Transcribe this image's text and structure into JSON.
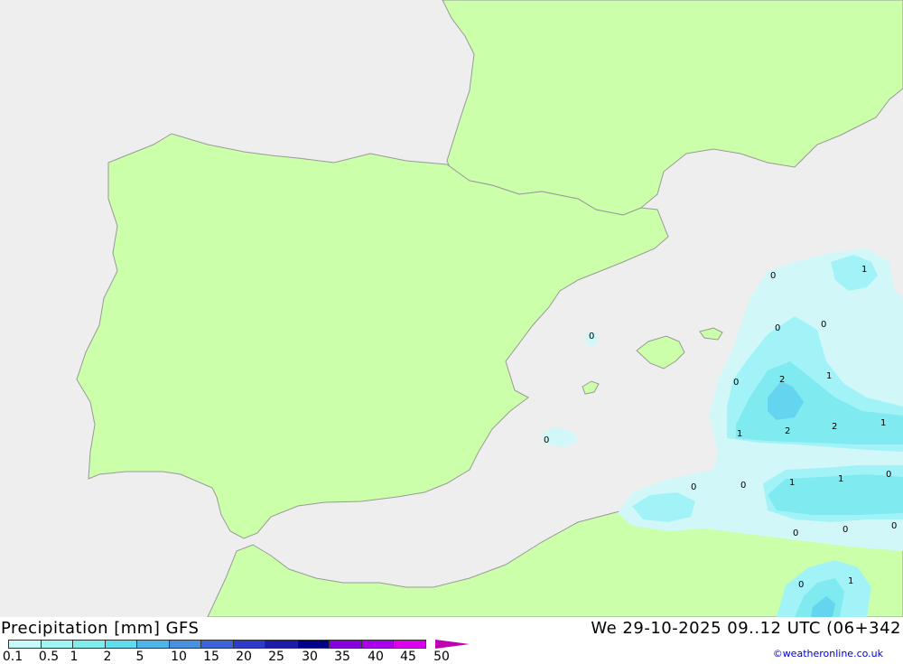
{
  "colors": {
    "sea": "#eeeeee",
    "land": "#ccffaa",
    "coast": "#999999",
    "precip_light": "#d2f7f8",
    "precip_mid": "#a2f3f8",
    "precip_heavy": "#7feaf0",
    "precip_heavier": "#63d5ee"
  },
  "footer": {
    "title": "Precipitation [mm] GFS",
    "valid_time": "We 29-10-2025 09..12 UTC (06+342",
    "copyright": "©weatheronline.co.uk"
  },
  "legend": {
    "colors": [
      "#c8f8f8",
      "#a0f4f4",
      "#80ecec",
      "#60dcec",
      "#50b4e8",
      "#4890e0",
      "#3c64d8",
      "#2c3cc8",
      "#1c1ca8",
      "#000088",
      "#8800dd",
      "#aa00ee",
      "#dd00ee",
      "#ee00cc",
      "#c000b0"
    ],
    "labels": [
      "0.1",
      "0.5",
      "1",
      "2",
      "5",
      "10",
      "15",
      "20",
      "25",
      "30",
      "35",
      "40",
      "45",
      "50"
    ]
  },
  "contour_labels": [
    "0",
    "1",
    "0",
    "0",
    "0",
    "0",
    "2",
    "1",
    "1",
    "2",
    "2",
    "1",
    "0",
    "0",
    "0",
    "1",
    "1",
    "0",
    "0",
    "0",
    "0",
    "0",
    "1"
  ]
}
